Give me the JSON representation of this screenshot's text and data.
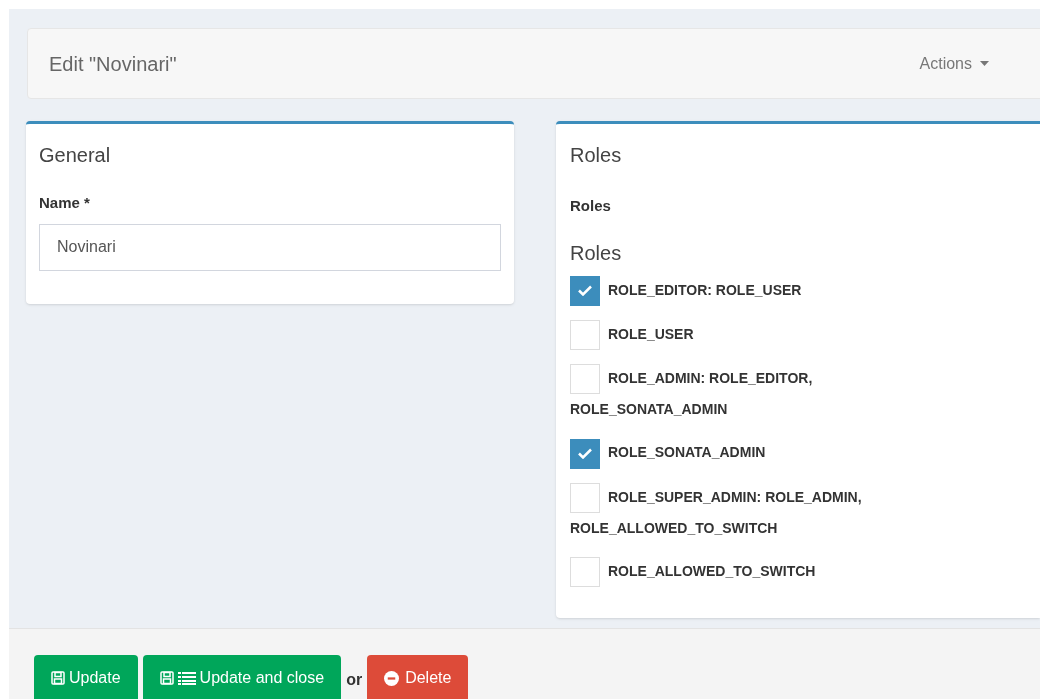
{
  "header": {
    "title": "Edit \"Novinari\"",
    "actions": "Actions"
  },
  "general": {
    "title": "General",
    "name_label": "Name *",
    "name_value": "Novinari"
  },
  "roles": {
    "title": "Roles",
    "label": "Roles",
    "group_title": "Roles",
    "items": [
      {
        "label": "ROLE_EDITOR: ROLE_USER",
        "checked": true
      },
      {
        "label": "ROLE_USER",
        "checked": false
      },
      {
        "label": "ROLE_ADMIN: ROLE_EDITOR, ROLE_SONATA_ADMIN",
        "checked": false
      },
      {
        "label": "ROLE_SONATA_ADMIN",
        "checked": true
      },
      {
        "label": "ROLE_SUPER_ADMIN: ROLE_ADMIN, ROLE_ALLOWED_TO_SWITCH",
        "checked": false
      },
      {
        "label": "ROLE_ALLOWED_TO_SWITCH",
        "checked": false
      }
    ]
  },
  "footer": {
    "buttons": [
      {
        "kind": "update",
        "label": "Update"
      },
      {
        "kind": "update_close",
        "label": "Update and close"
      },
      {
        "kind": "separator",
        "label": "or"
      },
      {
        "kind": "delete",
        "label": "Delete"
      }
    ]
  }
}
